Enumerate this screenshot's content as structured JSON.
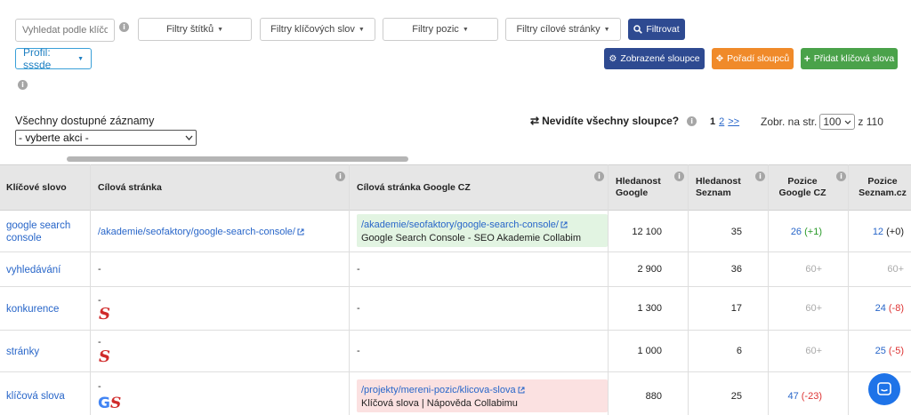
{
  "search": {
    "placeholder": "Vyhledat podle klíčové"
  },
  "filters": [
    {
      "label": "Filtry štítků"
    },
    {
      "label": "Filtry klíčových slov"
    },
    {
      "label": "Filtry pozic"
    },
    {
      "label": "Filtry cílové stránky"
    }
  ],
  "filter_button": "Filtrovat",
  "profile": "Profil: sssde",
  "actions": {
    "columns_shown": "Zobrazené sloupce",
    "column_order": "Pořadí sloupců",
    "add_keywords": "Přidat klíčová slova"
  },
  "records_label": "Všechny dostupné záznamy",
  "action_select": "- vyberte akci -",
  "cols_question": "Nevidíte všechny sloupce?",
  "pager": {
    "current": "1",
    "next": "2",
    "last": ">>"
  },
  "per_page": {
    "label": "Zobr. na str.",
    "value": "100",
    "total": "z 110"
  },
  "headers": {
    "keyword": "Klíčové slovo",
    "target": "Cílová stránka",
    "target_google": "Cílová stránka Google CZ",
    "search_google": "Hledanost Google",
    "search_seznam": "Hledanost Seznam",
    "pos_google": "Pozice Google CZ",
    "pos_seznam": "Pozice Seznam.cz"
  },
  "rows": [
    {
      "keyword": "google search console",
      "target": "/akademie/seofaktory/google-search-console/",
      "g_url": "/akademie/seofaktory/google-search-console/",
      "g_title": "Google Search Console - SEO Akademie Collabim",
      "hg": "12 100",
      "hs": "35",
      "pg": "26",
      "pg_d": "(+1)",
      "ps": "12",
      "ps_d": "(+0)"
    },
    {
      "keyword": "vyhledávání",
      "target": "-",
      "g_url": "-",
      "hg": "2 900",
      "hs": "36",
      "pg": "60+",
      "ps": "60+"
    },
    {
      "keyword": "konkurence",
      "target": "-",
      "g_url": "-",
      "hg": "1 300",
      "hs": "17",
      "pg": "60+",
      "ps": "24",
      "ps_d": "(-8)"
    },
    {
      "keyword": "stránky",
      "target": "-",
      "g_url": "-",
      "hg": "1 000",
      "hs": "6",
      "pg": "60+",
      "ps": "25",
      "ps_d": "(-5)"
    },
    {
      "keyword": "klíčová slova",
      "target": "-",
      "g_url": "/projekty/mereni-pozic/klicova-slova",
      "g_title": "Klíčová slova | Nápověda Collabimu",
      "hg": "880",
      "hs": "25",
      "pg": "47",
      "pg_d": "(-23)"
    }
  ],
  "icons": {
    "info": "info-icon",
    "caret": "caret-down-icon",
    "cog": "cog-icon",
    "move": "arrows-move-icon",
    "plus": "plus-icon",
    "swap": "swap-arrows-icon",
    "ext": "external-link-icon",
    "chat": "chat-icon"
  },
  "colors": {
    "navy": "#2e4a91",
    "orange": "#f08a2a",
    "green": "#4aa24a",
    "link": "#2866c9"
  }
}
